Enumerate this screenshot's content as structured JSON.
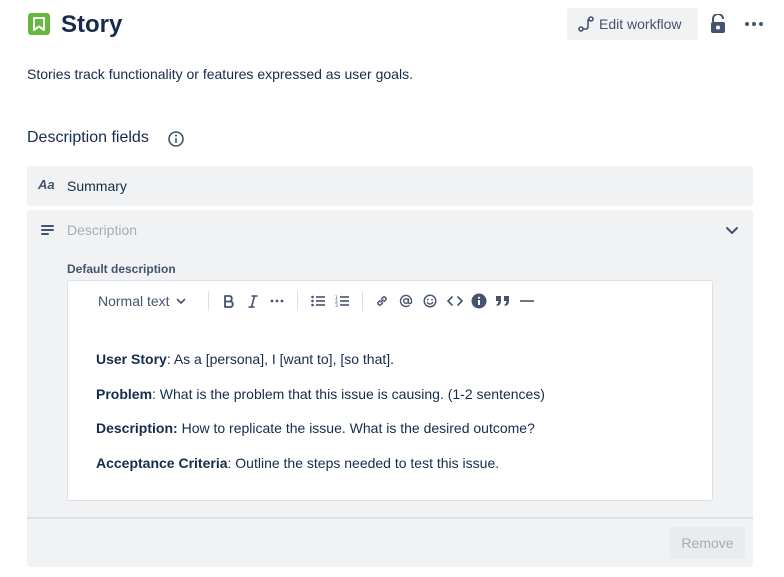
{
  "header": {
    "title": "Story",
    "icon": "bookmark-icon",
    "edit_workflow_label": "Edit workflow",
    "lock_icon": "unlock-icon",
    "more_icon": "more-icon"
  },
  "subtitle": "Stories track functionality or features expressed as user goals.",
  "section": {
    "title": "Description fields",
    "info_icon": "info-icon"
  },
  "fields": {
    "summary": {
      "icon_text": "Aa",
      "label": "Summary"
    },
    "description": {
      "label": "Description",
      "default_label": "Default description",
      "toolbar": {
        "text_style": "Normal text",
        "items": [
          "bold",
          "italic",
          "more-formatting",
          "bullet-list",
          "numbered-list",
          "link",
          "mention",
          "emoji",
          "code",
          "info-panel",
          "quote",
          "divider"
        ]
      },
      "content": [
        {
          "bold": "User Story",
          "rest": ": As a [persona], I [want to], [so that]."
        },
        {
          "bold": "Problem",
          "rest": ": What is the problem that this issue is causing. (1-2 sentences)"
        },
        {
          "bold": "Description:",
          "rest": " How to replicate the issue. What is the desired outcome?"
        },
        {
          "bold": "Acceptance Criteria",
          "rest": ": Outline the steps needed to test this issue."
        }
      ],
      "remove_label": "Remove"
    }
  },
  "colors": {
    "icon_green": "#63ba3c",
    "panel_bg": "#f1f2f4",
    "text": "#172b4d",
    "subtle_text": "#44546f",
    "placeholder": "#a5adba"
  }
}
